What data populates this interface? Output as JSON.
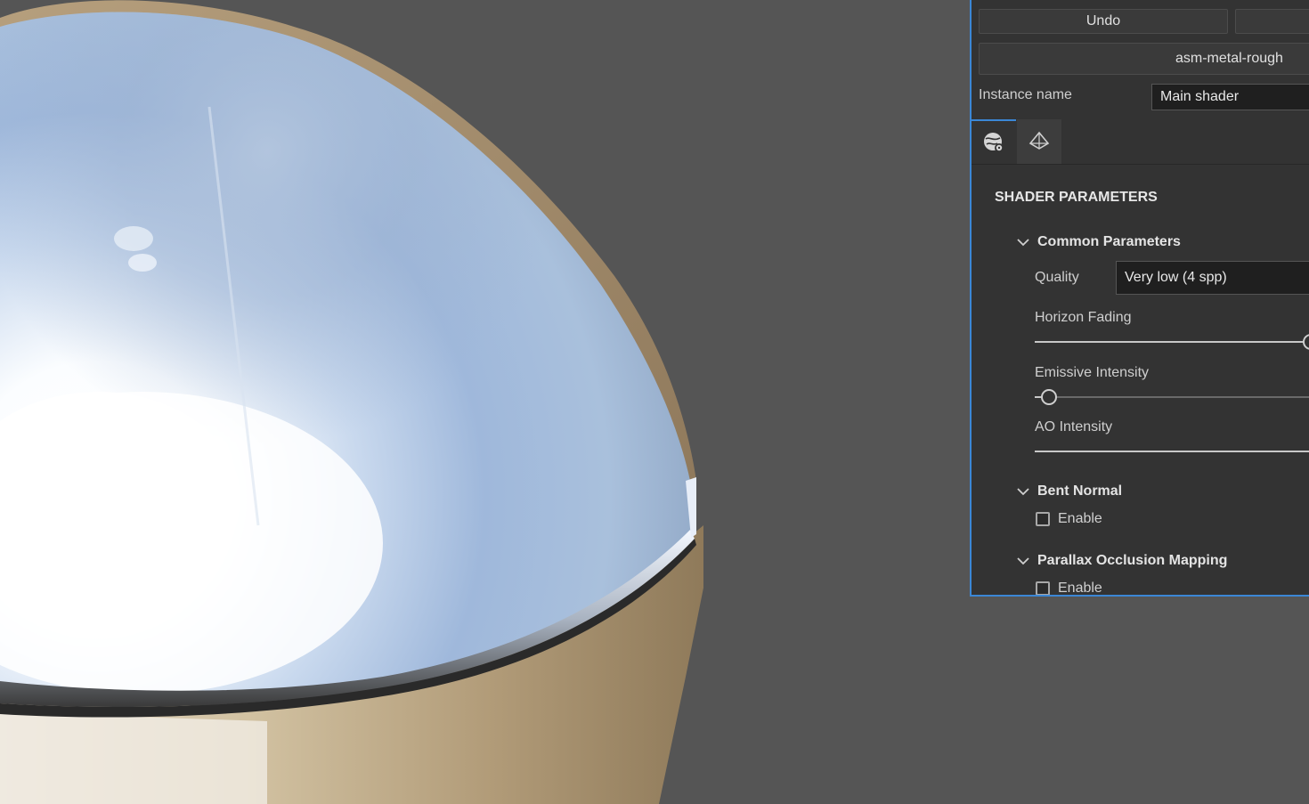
{
  "panel": {
    "undo_label": "Undo",
    "shader_name": "asm-metal-rough",
    "instance_label": "Instance name",
    "instance_value": "Main shader",
    "tabs": [
      {
        "icon": "shader-settings-icon"
      },
      {
        "icon": "geometry-icon"
      }
    ],
    "section_title": "SHADER PARAMETERS",
    "groups": {
      "common": {
        "title": "Common Parameters",
        "quality_label": "Quality",
        "quality_value": "Very low (4 spp)",
        "horizon_label": "Horizon Fading",
        "horizon_value": 1.0,
        "emissive_label": "Emissive Intensity",
        "emissive_value": 0.05,
        "ao_label": "AO Intensity",
        "ao_value": 1.0
      },
      "bent_normal": {
        "title": "Bent Normal",
        "enable_label": "Enable",
        "enabled": false
      },
      "pom": {
        "title": "Parallax Occlusion Mapping",
        "enable_label": "Enable",
        "enabled": false
      }
    },
    "accent_color": "#3b87d6"
  },
  "viewport": {
    "background_color": "#555555",
    "object": "metallic-sphere-model"
  }
}
